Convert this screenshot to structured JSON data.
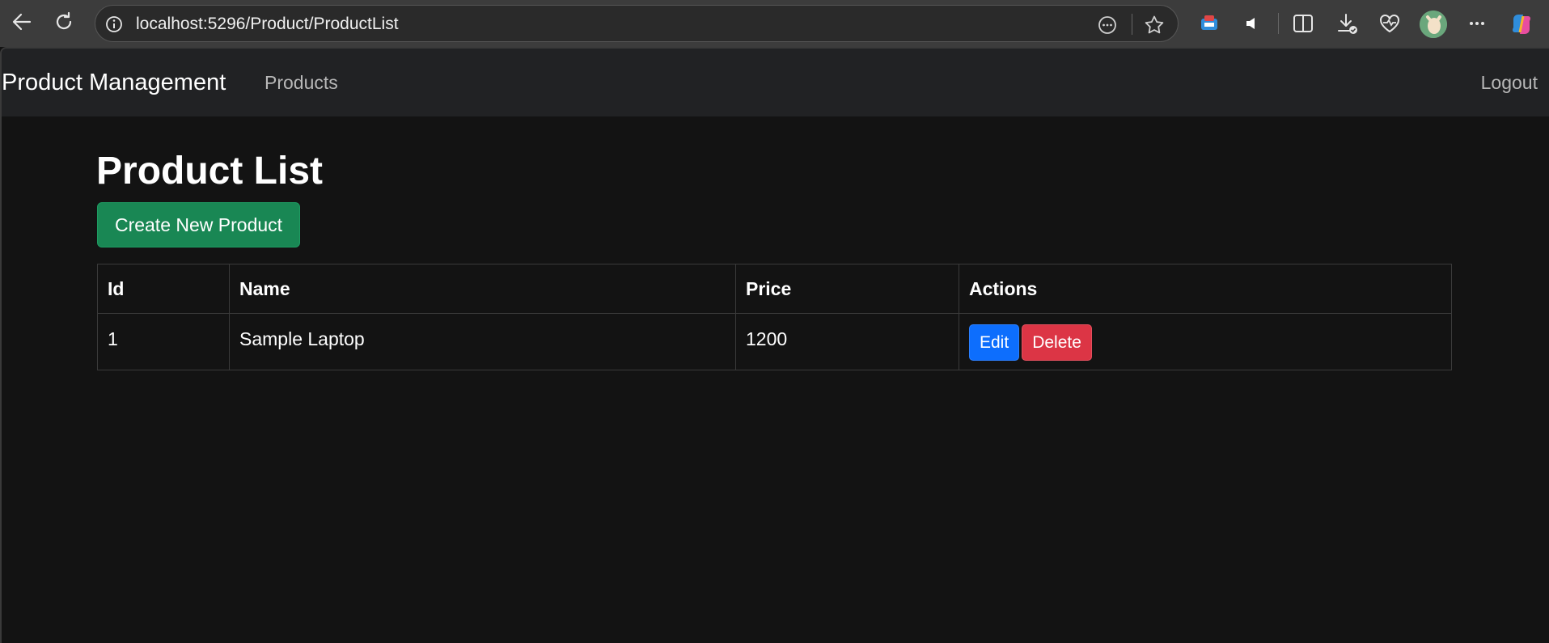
{
  "browser": {
    "url": "localhost:5296/Product/ProductList",
    "icons": [
      "back-arrow-icon",
      "refresh-icon",
      "site-info-icon",
      "reading-mode-icon",
      "favorite-star-icon",
      "extension-icon",
      "read-aloud-icon",
      "split-screen-icon",
      "downloads-icon",
      "health-icon",
      "profile-avatar",
      "more-options-icon",
      "copilot-icon"
    ]
  },
  "navbar": {
    "brand": "Product Management",
    "products_link": "Products",
    "logout_link": "Logout"
  },
  "main": {
    "title": "Product List",
    "create_button": "Create New Product",
    "table": {
      "headers": [
        "Id",
        "Name",
        "Price",
        "Actions"
      ],
      "rows": [
        {
          "id": "1",
          "name": "Sample Laptop",
          "price": "1200",
          "edit": "Edit",
          "delete": "Delete"
        }
      ]
    }
  },
  "colors": {
    "success": "#198754",
    "primary": "#0d6efd",
    "danger": "#dc3545",
    "navbar_bg": "#212224",
    "page_bg": "#131313"
  }
}
